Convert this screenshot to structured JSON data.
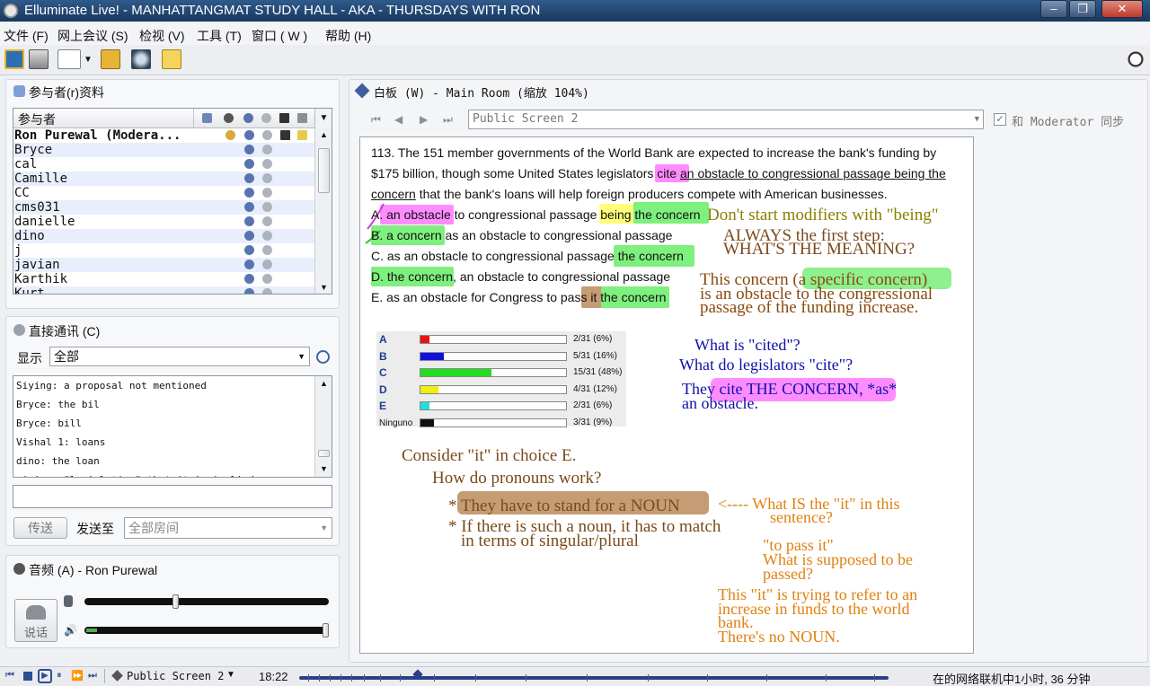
{
  "window": {
    "title": "Elluminate Live! - MANHATTANGMAT STUDY HALL - AKA - THURSDAYS WITH RON",
    "minimize": "‒",
    "restore": "❐",
    "close": "✕"
  },
  "menu": [
    "文件 (F)",
    "网上会议 (S)",
    "检视 (V)",
    "工具 (T)",
    "窗口 ( W )",
    "帮助 (H)"
  ],
  "participants": {
    "title": "参与者(r)资料",
    "column_header": "参与者",
    "rows": [
      {
        "name": "Ron Purewal (Modera..."
      },
      {
        "name": "Bryce"
      },
      {
        "name": "cal"
      },
      {
        "name": "Camille"
      },
      {
        "name": "CC"
      },
      {
        "name": "cms031"
      },
      {
        "name": "danielle"
      },
      {
        "name": "dino"
      },
      {
        "name": "j"
      },
      {
        "name": "javian"
      },
      {
        "name": "Karthik"
      },
      {
        "name": "Kurt"
      }
    ]
  },
  "chat": {
    "title": "直接通讯 (C)",
    "show_label": "显示",
    "show_value": "全部",
    "messages": [
      "Siying: a proposal not mentioned",
      "Bryce: the bil",
      "Bryce: bill",
      "Vishal 1: loans",
      "dino: the loan",
      "siying: \"legislation\" that it is implied"
    ],
    "input_value": "",
    "send_label": "传送",
    "send_to_label": "发送至",
    "send_to_value": "全部房间"
  },
  "audio": {
    "title": "音频 (A) - Ron Purewal",
    "talk_label": "说话",
    "mic_level": 0.37,
    "speaker_level": 1.0
  },
  "whiteboard": {
    "title": "白板 (W) - Main Room (缩放 104%)",
    "screen_select": "Public Screen 2",
    "sync_label": "和 Moderator 同步",
    "sync_checked": true,
    "question": {
      "line1": "113. The 151 member governments of the World Bank are expected to increase the bank's funding by",
      "line2a": "$175 billion, though some United States legislators cite ",
      "line2b": "an obstacle to congressional passage being the",
      "line3a": "concern",
      "line3b": " that the bank's loans will help foreign producers compete with American businesses.",
      "choices": [
        "A. an obstacle to congressional passage being the concern",
        "B. a concern as an obstacle to congressional passage",
        "C. as an obstacle to congressional passage the concern",
        "D. the concern, an obstacle to congressional passage",
        "E. as an obstacle for Congress to pass it the concern"
      ]
    },
    "poll": [
      {
        "label": "A",
        "count": "2/31 (6%)",
        "fraction": 0.06,
        "color": "#ee1111"
      },
      {
        "label": "B",
        "count": "5/31 (16%)",
        "fraction": 0.16,
        "color": "#1111dd"
      },
      {
        "label": "C",
        "count": "15/31 (48%)",
        "fraction": 0.48,
        "color": "#22dd22"
      },
      {
        "label": "D",
        "count": "4/31 (12%)",
        "fraction": 0.12,
        "color": "#eeee11"
      },
      {
        "label": "E",
        "count": "2/31 (6%)",
        "fraction": 0.06,
        "color": "#22dddd"
      },
      {
        "label": "Ninguno",
        "count": "3/31 (9%)",
        "fraction": 0.09,
        "color": "#111111"
      }
    ],
    "notes": {
      "being": "Don't start modifiers with \"being\"",
      "always1": "ALWAYS the first step:",
      "always2": "WHAT'S THE MEANING?",
      "concern1a": "This concern ",
      "concern1b": "(a specific concern)",
      "concern2": "is an obstacle to the congressional",
      "concern3": "passage of the funding increase.",
      "cited1": "What is \"cited\"?",
      "cited2": "What do legislators \"cite\"?",
      "cited3a": "They cite THE CONCERN,",
      "cited3b": " *as*",
      "cited4": "an obstacle.",
      "consider": "Consider \"it\" in choice E.",
      "pronouns": "How do pronouns work?",
      "stand_star": "* ",
      "stand": "They have to stand for a NOUN",
      "match1": "* If there is such a noun, it has to match",
      "match2": "in terms of singular/plural",
      "whatis1": "<---- What IS the \"it\" in this",
      "whatis2": "sentence?",
      "topass1": "\"to pass it\"",
      "topass2": "What is supposed to be",
      "topass3": "passed?",
      "increase1": "This \"it\" is trying to refer to an",
      "increase2": "increase in funds to the world",
      "increase3": "bank.",
      "increase4": "There's no NOUN."
    }
  },
  "statusbar": {
    "screen": "Public Screen 2",
    "time": "18:22",
    "online": "在的网络联机中1小时, 36 分钟"
  }
}
